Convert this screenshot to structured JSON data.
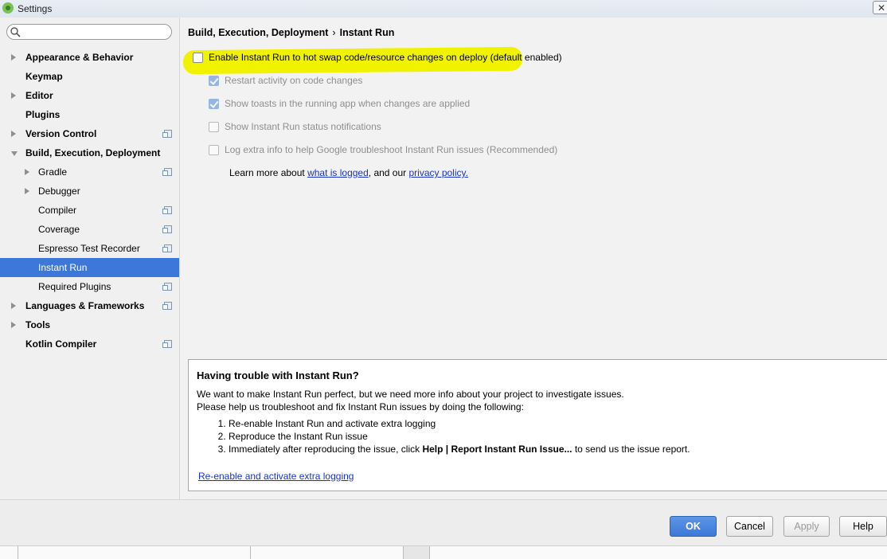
{
  "window": {
    "title": "Settings",
    "icon": "android-studio-icon",
    "close_glyph": "✕"
  },
  "search": {
    "value": "",
    "placeholder": ""
  },
  "tree": [
    {
      "label": "Appearance & Behavior",
      "level": 0,
      "arrow": "right",
      "proj": false
    },
    {
      "label": "Keymap",
      "level": 0,
      "arrow": "",
      "proj": false
    },
    {
      "label": "Editor",
      "level": 0,
      "arrow": "right",
      "proj": false
    },
    {
      "label": "Plugins",
      "level": 0,
      "arrow": "",
      "proj": false
    },
    {
      "label": "Version Control",
      "level": 0,
      "arrow": "right",
      "proj": true
    },
    {
      "label": "Build, Execution, Deployment",
      "level": 0,
      "arrow": "down",
      "proj": false
    },
    {
      "label": "Gradle",
      "level": 1,
      "arrow": "right",
      "proj": true
    },
    {
      "label": "Debugger",
      "level": 1,
      "arrow": "right",
      "proj": false
    },
    {
      "label": "Compiler",
      "level": 1,
      "arrow": "",
      "proj": true
    },
    {
      "label": "Coverage",
      "level": 1,
      "arrow": "",
      "proj": true
    },
    {
      "label": "Espresso Test Recorder",
      "level": 1,
      "arrow": "",
      "proj": true
    },
    {
      "label": "Instant Run",
      "level": 1,
      "arrow": "",
      "proj": false,
      "selected": true
    },
    {
      "label": "Required Plugins",
      "level": 1,
      "arrow": "",
      "proj": true
    },
    {
      "label": "Languages & Frameworks",
      "level": 0,
      "arrow": "right",
      "proj": true
    },
    {
      "label": "Tools",
      "level": 0,
      "arrow": "right",
      "proj": false
    },
    {
      "label": "Kotlin Compiler",
      "level": 0,
      "arrow": "",
      "proj": true
    }
  ],
  "breadcrumb": {
    "parent": "Build, Execution, Deployment",
    "separator": "›",
    "current": "Instant Run"
  },
  "options": {
    "enable": {
      "label": "Enable Instant Run to hot swap code/resource changes on deploy (default enabled)",
      "checked": false
    },
    "restart": {
      "label": "Restart activity on code changes",
      "checked": true
    },
    "toasts": {
      "label": "Show toasts in the running app when changes are applied",
      "checked": true
    },
    "notifications": {
      "label": "Show Instant Run status notifications",
      "checked": false
    },
    "log_extra": {
      "label": "Log extra info to help Google troubleshoot Instant Run issues (Recommended)",
      "checked": false
    }
  },
  "learn_more": {
    "prefix": "Learn more about ",
    "link1": "what is logged",
    "middle": ", and our ",
    "link2": "privacy policy."
  },
  "trouble": {
    "title": "Having trouble with Instant Run?",
    "line1": "We want to make Instant Run perfect, but we need more info about your project to investigate issues.",
    "line2": "Please help us troubleshoot and fix Instant Run issues by doing the following:",
    "steps": [
      "Re-enable Instant Run and activate extra logging",
      "Reproduce the Instant Run issue"
    ],
    "step3_prefix": "Immediately after reproducing the issue, click ",
    "step3_bold": "Help | Report Instant Run Issue...",
    "step3_suffix": " to send us the issue report.",
    "link": "Re-enable and activate extra logging"
  },
  "buttons": {
    "ok": "OK",
    "cancel": "Cancel",
    "apply": "Apply",
    "help": "Help"
  }
}
